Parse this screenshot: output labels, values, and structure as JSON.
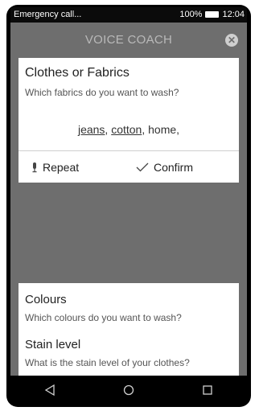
{
  "status_bar": {
    "notification": "Emergency call...",
    "battery": "100%",
    "time": "12:04"
  },
  "header": {
    "title": "VOICE COACH",
    "close_icon": "close-icon"
  },
  "question_card": {
    "title": "Clothes or Fabrics",
    "subtitle": "Which fabrics do you want to wash?",
    "answer": {
      "word1": "jeans",
      "sep1": ", ",
      "word2": "cotton",
      "rest": ", home,"
    },
    "repeat_label": "Repeat",
    "confirm_label": "Confirm"
  },
  "next_questions": [
    {
      "title": "Colours",
      "subtitle": "Which colours do you want to wash?"
    },
    {
      "title": "Stain level",
      "subtitle": "What is the stain level of your clothes?"
    }
  ],
  "nav_bar": {
    "icons": [
      "back-icon",
      "home-icon",
      "recents-icon"
    ]
  },
  "colors": {
    "screen_bg": "#6e6e6e",
    "card_bg": "#ffffff",
    "status_bar_bg": "#0b0b0b"
  }
}
